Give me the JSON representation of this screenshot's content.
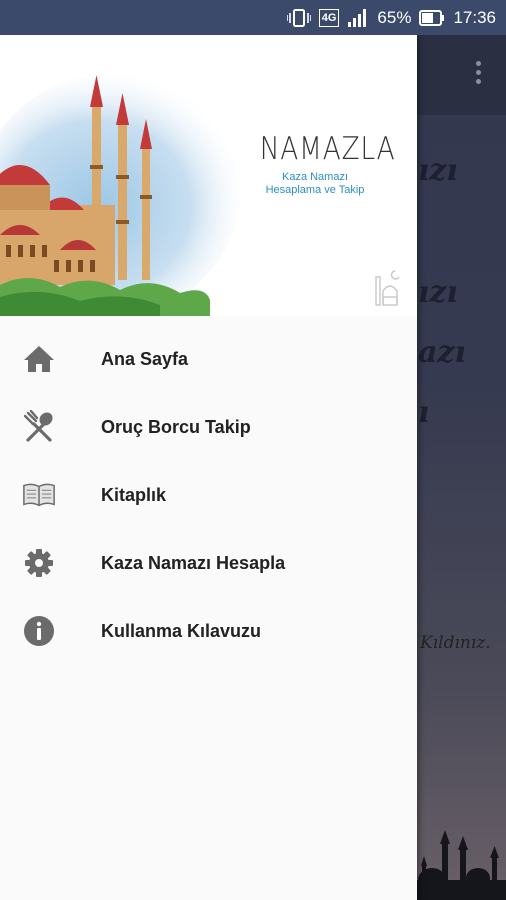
{
  "status_bar": {
    "network": "4G",
    "battery": "65%",
    "time": "17:36"
  },
  "drawer": {
    "header": {
      "app_name": "NAMAZLA",
      "subtitle_line1": "Kaza Namazı",
      "subtitle_line2": "Hesaplama ve Takip"
    },
    "items": [
      {
        "label": "Ana Sayfa",
        "icon": "home-icon"
      },
      {
        "label": "Oruç Borcu Takip",
        "icon": "fork-spoon-icon"
      },
      {
        "label": "Kitaplık",
        "icon": "book-icon"
      },
      {
        "label": "Kaza Namazı Hesapla",
        "icon": "gear-icon"
      },
      {
        "label": "Kullanma Kılavuzu",
        "icon": "info-icon"
      }
    ]
  },
  "background": {
    "fragments": [
      "ızı",
      "ızı",
      "azı",
      "ı"
    ],
    "footer_text": "Kıldınız."
  }
}
